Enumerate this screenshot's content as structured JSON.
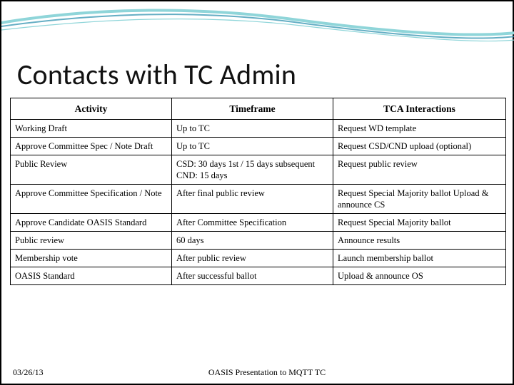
{
  "title": "Contacts with TC Admin",
  "headers": {
    "activity": "Activity",
    "timeframe": "Timeframe",
    "tca": "TCA Interactions"
  },
  "rows": [
    {
      "activity": "Working Draft",
      "timeframe": "Up to TC",
      "tca": "Request WD template"
    },
    {
      "activity": "Approve Committee Spec / Note Draft",
      "timeframe": "Up to TC",
      "tca": "Request CSD/CND upload (optional)"
    },
    {
      "activity": "Public Review",
      "timeframe": "CSD: 30 days 1st /\n15 days subsequent\nCND: 15 days",
      "tca": "Request public review"
    },
    {
      "activity": "Approve Committee Specification / Note",
      "timeframe": "After final public review",
      "tca": "Request Special Majority ballot\nUpload & announce CS"
    },
    {
      "activity": "Approve Candidate OASIS Standard",
      "timeframe": "After Committee Specification",
      "tca": "Request Special Majority ballot"
    },
    {
      "activity": "Public review",
      "timeframe": "60 days",
      "tca": "Announce results"
    },
    {
      "activity": "Membership vote",
      "timeframe": "After public review",
      "tca": "Launch membership ballot"
    },
    {
      "activity": "OASIS Standard",
      "timeframe": "After successful ballot",
      "tca": "Upload & announce OS"
    }
  ],
  "footer": {
    "date": "03/26/13",
    "center": "OASIS Presentation to MQTT TC"
  }
}
